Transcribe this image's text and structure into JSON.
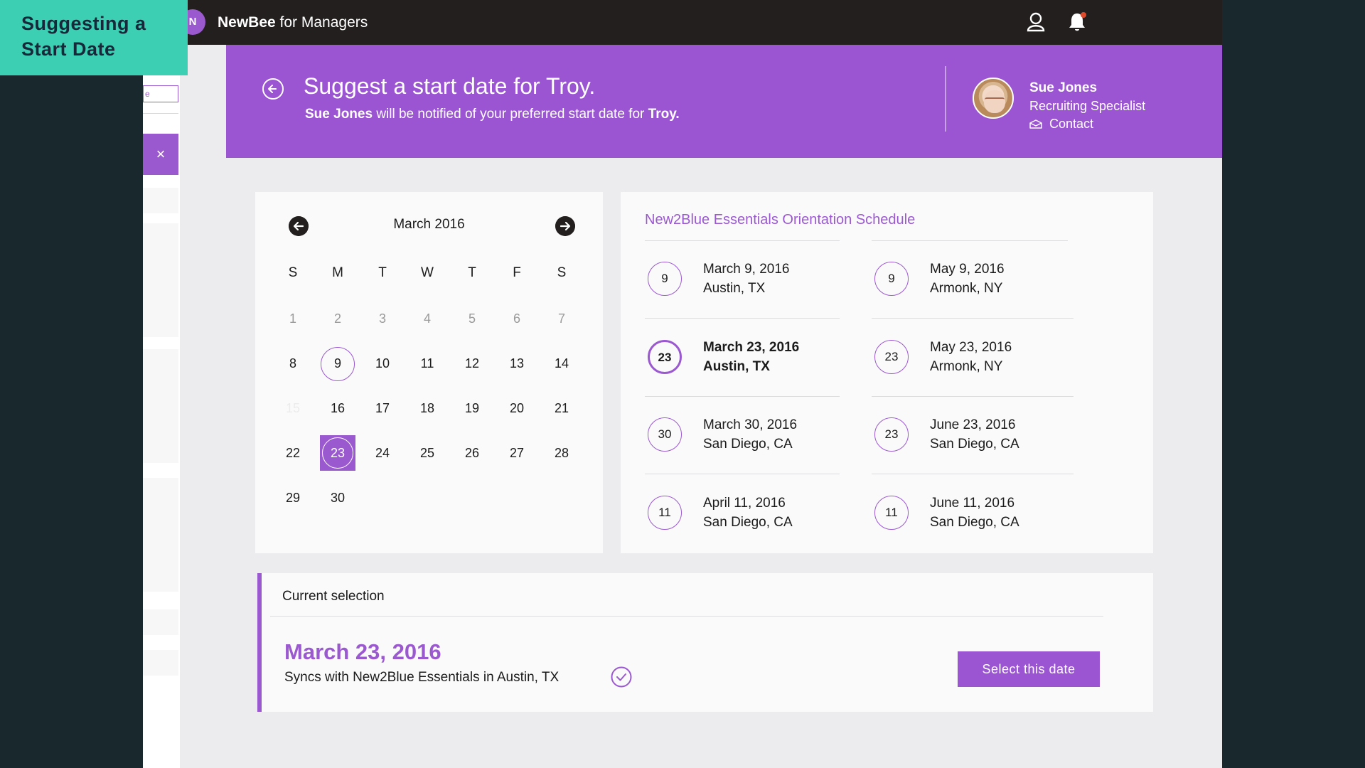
{
  "overlay_label": {
    "line1": "Suggesting a",
    "line2": "Start Date"
  },
  "topbar": {
    "brand_bold": "NewBee",
    "brand_rest": " for Managers",
    "logo_text": "N",
    "icons": [
      "user-icon",
      "bell-icon"
    ]
  },
  "left_rail": {
    "search_fragment": "e",
    "close_glyph": "×"
  },
  "header": {
    "title": "Suggest a start date for Troy.",
    "subtitle_name": "Sue Jones",
    "subtitle_mid": " will be notified of your preferred start date for ",
    "subtitle_target": "Troy.",
    "contact": {
      "name": "Sue Jones",
      "role": "Recruiting Specialist",
      "link": "Contact"
    }
  },
  "calendar": {
    "month_label": "March 2016",
    "weekdays": [
      "S",
      "M",
      "T",
      "W",
      "T",
      "F",
      "S"
    ],
    "weeks": [
      [
        "1",
        "2",
        "3",
        "4",
        "5",
        "6",
        "7"
      ],
      [
        "8",
        "9",
        "10",
        "11",
        "12",
        "13",
        "14"
      ],
      [
        "15",
        "16",
        "17",
        "18",
        "19",
        "20",
        "21"
      ],
      [
        "22",
        "23",
        "24",
        "25",
        "26",
        "27",
        "28"
      ],
      [
        "29",
        "30",
        "",
        "",
        "",
        "",
        ""
      ]
    ],
    "muted_days": [
      "1",
      "2",
      "3",
      "4",
      "5",
      "6",
      "7"
    ],
    "faint_days": [
      "15"
    ],
    "orientation_days": [
      "9"
    ],
    "selected_day": "23"
  },
  "schedule": {
    "title": "New2Blue Essentials Orientation Schedule",
    "left": [
      {
        "day": "9",
        "date": "March 9, 2016",
        "location": "Austin, TX",
        "active": false
      },
      {
        "day": "23",
        "date": "March 23, 2016",
        "location": "Austin, TX",
        "active": true
      },
      {
        "day": "30",
        "date": "March 30, 2016",
        "location": "San Diego, CA",
        "active": false
      },
      {
        "day": "11",
        "date": "April 11, 2016",
        "location": "San Diego, CA",
        "active": false
      }
    ],
    "right": [
      {
        "day": "9",
        "date": "May 9, 2016",
        "location": "Armonk, NY",
        "active": false
      },
      {
        "day": "23",
        "date": "May 23, 2016",
        "location": "Armonk, NY",
        "active": false
      },
      {
        "day": "23",
        "date": "June 23, 2016",
        "location": "San Diego, CA",
        "active": false
      },
      {
        "day": "11",
        "date": "June 11, 2016",
        "location": "San Diego, CA",
        "active": false
      }
    ]
  },
  "selection": {
    "label": "Current selection",
    "date": "March 23, 2016",
    "description": "Syncs with New2Blue Essentials in Austin, TX",
    "button_label": "Select this date"
  },
  "colors": {
    "accent": "#9b59d0",
    "header_band": "#9b55d3",
    "topbar": "#231f1f",
    "overlay_badge": "#3ccfb3",
    "background_outer": "#18282d"
  }
}
